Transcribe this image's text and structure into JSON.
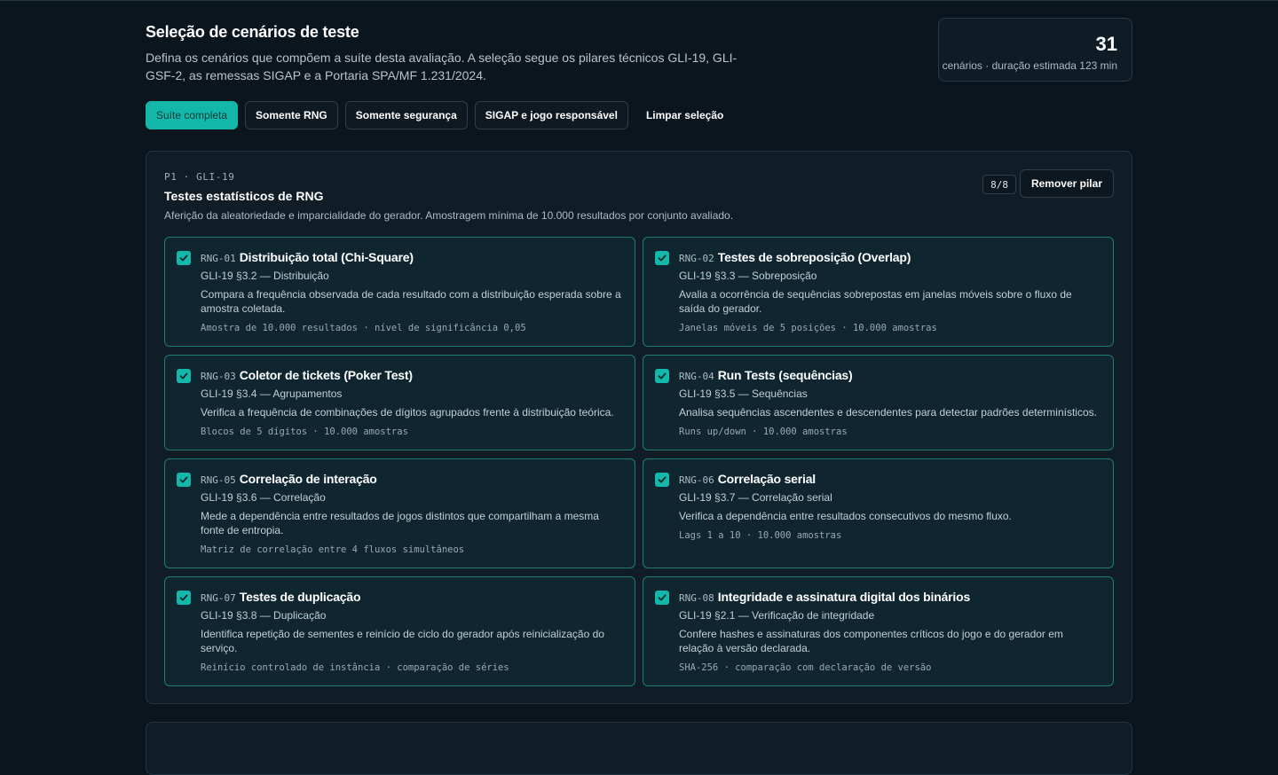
{
  "header": {
    "title": "Seleção de cenários de teste",
    "description": "Defina os cenários que compõem a suíte desta avaliação. A seleção segue os pilares técnicos GLI-19, GLI-GSF-2, as remessas SIGAP e a Portaria SPA/MF 1.231/2024."
  },
  "summary": {
    "count": "31",
    "meta": "cenários · duração estimada 123 min"
  },
  "filters": [
    {
      "label": "Suíte completa",
      "active": true
    },
    {
      "label": "Somente RNG"
    },
    {
      "label": "Somente segurança"
    },
    {
      "label": "SIGAP e jogo responsável"
    },
    {
      "label": "Limpar seleção"
    }
  ],
  "pillar": {
    "code": "P1 · GLI-19",
    "title": "Testes estatísticos de RNG",
    "description": "Aferição da aleatoriedade e imparcialidade do gerador. Amostragem mínima de 10.000 resultados por conjunto avaliado.",
    "badge": "8/8",
    "remove_label": "Remover pilar",
    "scenarios": [
      {
        "code": "RNG-01",
        "name": "Distribuição total (Chi-Square)",
        "ref": "GLI-19 §3.2 — Distribuição",
        "text": "Compara a frequência observada de cada resultado com a distribuição esperada sobre a amostra coletada.",
        "note": "Amostra de 10.000 resultados · nível de significância 0,05",
        "checked": true
      },
      {
        "code": "RNG-02",
        "name": "Testes de sobreposição (Overlap)",
        "ref": "GLI-19 §3.3 — Sobreposição",
        "text": "Avalia a ocorrência de sequências sobrepostas em janelas móveis sobre o fluxo de saída do gerador.",
        "note": "Janelas móveis de 5 posições · 10.000 amostras",
        "checked": true
      },
      {
        "code": "RNG-03",
        "name": "Coletor de tickets (Poker Test)",
        "ref": "GLI-19 §3.4 — Agrupamentos",
        "text": "Verifica a frequência de combinações de dígitos agrupados frente à distribuição teórica.",
        "note": "Blocos de 5 dígitos · 10.000 amostras",
        "checked": true
      },
      {
        "code": "RNG-04",
        "name": "Run Tests (sequências)",
        "ref": "GLI-19 §3.5 — Sequências",
        "text": "Analisa sequências ascendentes e descendentes para detectar padrões determinísticos.",
        "note": "Runs up/down · 10.000 amostras",
        "checked": true
      },
      {
        "code": "RNG-05",
        "name": "Correlação de interação",
        "ref": "GLI-19 §3.6 — Correlação",
        "text": "Mede a dependência entre resultados de jogos distintos que compartilham a mesma fonte de entropia.",
        "note": "Matriz de correlação entre 4 fluxos simultâneos",
        "checked": true
      },
      {
        "code": "RNG-06",
        "name": "Correlação serial",
        "ref": "GLI-19 §3.7 — Correlação serial",
        "text": "Verifica a dependência entre resultados consecutivos do mesmo fluxo.",
        "note": "Lags 1 a 10 · 10.000 amostras",
        "checked": true
      },
      {
        "code": "RNG-07",
        "name": "Testes de duplicação",
        "ref": "GLI-19 §3.8 — Duplicação",
        "text": "Identifica repetição de sementes e reinício de ciclo do gerador após reinicialização do serviço.",
        "note": "Reinício controlado de instância · comparação de séries",
        "checked": true
      },
      {
        "code": "RNG-08",
        "name": "Integridade e assinatura digital dos binários",
        "ref": "GLI-19 §2.1 — Verificação de integridade",
        "text": "Confere hashes e assinaturas dos componentes críticos do jogo e do gerador em relação à versão declarada.",
        "note": "SHA-256 · comparação com declaração de versão",
        "checked": true
      }
    ]
  },
  "colors": {
    "accent": "#14b8aa",
    "background": "#0b151e",
    "card_border": "#1f7d75"
  }
}
